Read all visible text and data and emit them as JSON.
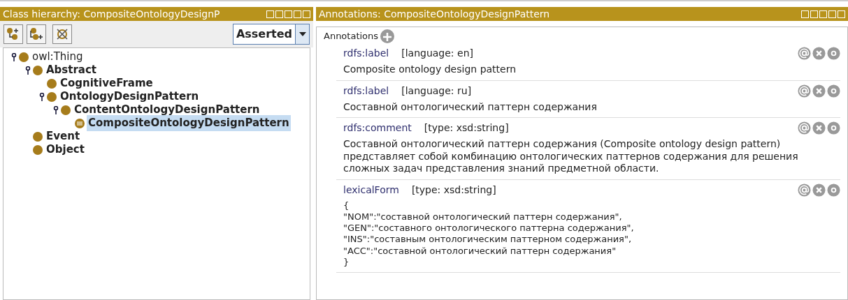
{
  "left_panel": {
    "title": "Class hierarchy: CompositeOntologyDesignP",
    "toolbar": {
      "view_select": "Asserted"
    },
    "tree": [
      {
        "label": "owl:Thing",
        "kind": "root",
        "expanded": true,
        "selected": false,
        "children": [
          {
            "label": "Abstract",
            "kind": "class",
            "expanded": true,
            "selected": false,
            "children": [
              {
                "label": "CognitiveFrame",
                "kind": "class",
                "selected": false
              },
              {
                "label": "OntologyDesignPattern",
                "kind": "class",
                "expanded": true,
                "selected": false,
                "children": [
                  {
                    "label": "ContentOntologyDesignPattern",
                    "kind": "class",
                    "expanded": true,
                    "selected": false,
                    "children": [
                      {
                        "label": "CompositeOntologyDesignPattern",
                        "kind": "defined",
                        "selected": true
                      }
                    ]
                  }
                ]
              }
            ]
          },
          {
            "label": "Event",
            "kind": "class",
            "selected": false
          },
          {
            "label": "Object",
            "kind": "class",
            "selected": false
          }
        ]
      }
    ]
  },
  "right_panel": {
    "title": "Annotations: CompositeOntologyDesignPattern",
    "section_label": "Annotations",
    "annotations": [
      {
        "property": "rdfs:label",
        "qualifier": "[language: en]",
        "value_lines": [
          "Composite ontology design pattern"
        ]
      },
      {
        "property": "rdfs:label",
        "qualifier": "[language: ru]",
        "value_lines": [
          "Составной онтологический паттерн содержания"
        ]
      },
      {
        "property": "rdfs:comment",
        "qualifier": "[type: xsd:string]",
        "value_lines": [
          "Составной онтологический паттерн содержания (Composite ontology design pattern) представляет собой комбинацию онтологических паттернов содержания для решения сложных задач представления знаний предметной области."
        ]
      },
      {
        "property": "lexicalForm",
        "qualifier": "[type: xsd:string]",
        "value_lines": [
          "{",
          "\"NOM\":\"составной онтологический паттерн содержания\",",
          "\"GEN\":\"составного онтологического паттерна содержания\",",
          "\"INS\":\"составным онтологическим паттерном содержания\",",
          "\"ACC\":\"составной онтологический паттерн содержания\"",
          "}"
        ]
      }
    ]
  }
}
